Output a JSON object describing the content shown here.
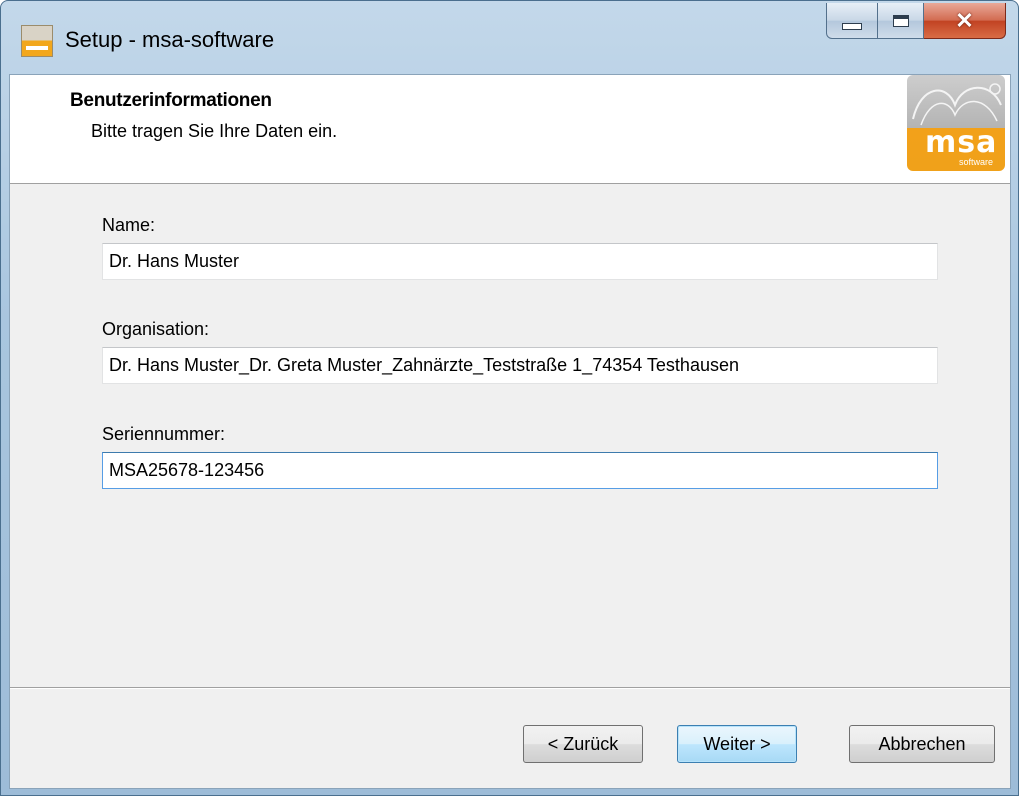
{
  "window": {
    "title": "Setup - msa-software"
  },
  "header": {
    "title": "Benutzerinformationen",
    "subtitle": "Bitte tragen Sie Ihre Daten ein.",
    "logo_text": "msa",
    "logo_subtext": "software"
  },
  "form": {
    "name_label": "Name:",
    "name_value": "Dr. Hans Muster",
    "organisation_label": "Organisation:",
    "organisation_value": "Dr. Hans Muster_Dr. Greta Muster_Zahnärzte_Teststraße 1_74354 Testhausen",
    "serial_label": "Seriennummer:",
    "serial_value": "MSA25678-123456"
  },
  "buttons": {
    "back": "< Zurück",
    "next": "Weiter >",
    "cancel": "Abbrechen"
  },
  "colors": {
    "accent": "#f2a11a",
    "focus_border": "#569de5"
  }
}
